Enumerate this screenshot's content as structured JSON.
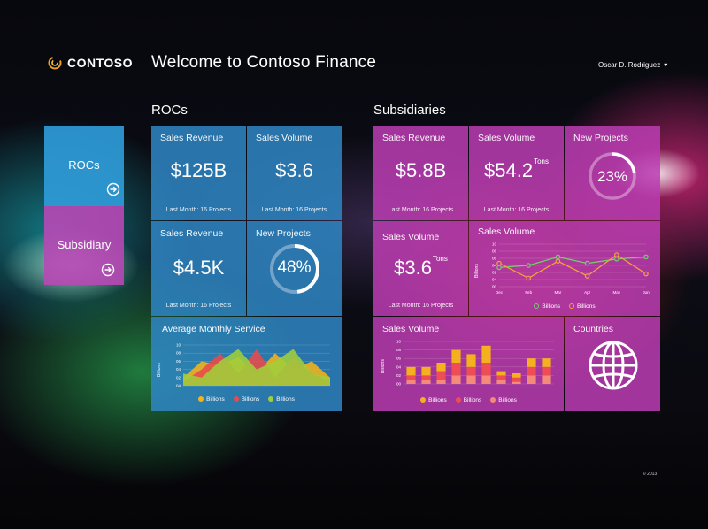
{
  "header": {
    "brand": "CONTOSO",
    "welcome": "Welcome to Contoso Finance",
    "user": "Oscar D. Rodriguez",
    "user_caret": "▾"
  },
  "nav": {
    "items": [
      {
        "label": "ROCs",
        "icon": "arrow-right-circle-icon",
        "color": "#2f9bd8"
      },
      {
        "label": "Subsidiary",
        "icon": "arrow-right-circle-icon",
        "color": "#b848b6"
      }
    ]
  },
  "sections": {
    "rocs": "ROCs",
    "subsidiaries": "Subsidiaries"
  },
  "rocs": {
    "t1": {
      "caption": "Sales Revenue",
      "value": "$125B",
      "footer": "Last Month: 16 Projects"
    },
    "t2": {
      "caption": "Sales Volume",
      "value": "$3.6",
      "footer": "Last Month: 16 Projects"
    },
    "t3": {
      "caption": "Sales Revenue",
      "value": "$4.5K",
      "footer": "Last Month: 16 Projects"
    },
    "t4": {
      "caption": "New Projects",
      "value": "48%",
      "progress": 0.48
    },
    "t5": {
      "caption": "Average Monthly Service"
    }
  },
  "subs": {
    "t1": {
      "caption": "Sales Revenue",
      "value": "$5.8B",
      "footer": "Last Month: 16 Projects"
    },
    "t2": {
      "caption": "Sales Volume",
      "value": "$54.2",
      "unit": "Tons",
      "footer": "Last Month: 16 Projects"
    },
    "t3": {
      "caption": "New Projects",
      "value": "23%",
      "progress": 0.23
    },
    "t4": {
      "caption": "Sales Volume",
      "value": "$3.6",
      "unit": "Tons",
      "footer": "Last Month: 16 Projects"
    },
    "t5": {
      "caption": "Sales Volume"
    },
    "t6": {
      "caption": "Sales Volume"
    },
    "t7": {
      "caption": "Countries",
      "icon": "globe-icon"
    }
  },
  "footer": {
    "copyright": "© 2013"
  },
  "chart_data": [
    {
      "type": "area",
      "title": "Average Monthly Service",
      "ylabel": "Billions",
      "y_ticks": [
        "10",
        "08",
        "06",
        "04",
        "02",
        "04"
      ],
      "series": [
        {
          "name": "Billions",
          "color": "#f2b418",
          "values": [
            2,
            6,
            5,
            7,
            3,
            8,
            4,
            6,
            2
          ]
        },
        {
          "name": "Billions",
          "color": "#e84a4a",
          "values": [
            1,
            4,
            8,
            3,
            9,
            2,
            7,
            3,
            1
          ]
        },
        {
          "name": "Billions",
          "color": "#9fcf3a",
          "values": [
            3,
            2,
            6,
            9,
            4,
            6,
            9,
            3,
            2
          ]
        }
      ]
    },
    {
      "type": "line",
      "ylabel": "Billions",
      "categories": [
        "Dec",
        "Feb",
        "Mar",
        "Apr",
        "May",
        "Jun"
      ],
      "y_ticks": [
        "10",
        "08",
        "06",
        "04",
        "02",
        "04",
        "00"
      ],
      "series": [
        {
          "name": "Billions",
          "color": "#6fd06a",
          "values": [
            4.5,
            5.0,
            7.0,
            5.5,
            6.5,
            7.0
          ]
        },
        {
          "name": "Billions",
          "color": "#f5a13a",
          "values": [
            5.5,
            2.0,
            6.0,
            2.5,
            7.5,
            3.0
          ]
        }
      ]
    },
    {
      "type": "bar",
      "ylabel": "Billions",
      "y_ticks": [
        "10",
        "08",
        "06",
        "04",
        "02",
        "00"
      ],
      "categories": [
        "1",
        "2",
        "3",
        "4",
        "5",
        "6",
        "7",
        "8",
        "9",
        "10"
      ],
      "series": [
        {
          "name": "Billions",
          "color": "#f5b020",
          "values": [
            2,
            2,
            2,
            3,
            3,
            4,
            1,
            1,
            2,
            2
          ]
        },
        {
          "name": "Billions",
          "color": "#ee4d55",
          "values": [
            1,
            1,
            2,
            3,
            2,
            3,
            1,
            1,
            2,
            2
          ]
        },
        {
          "name": "Billions",
          "color": "#f38a7a",
          "values": [
            1,
            1,
            1,
            2,
            2,
            2,
            1,
            0.5,
            2,
            2
          ]
        }
      ]
    }
  ]
}
